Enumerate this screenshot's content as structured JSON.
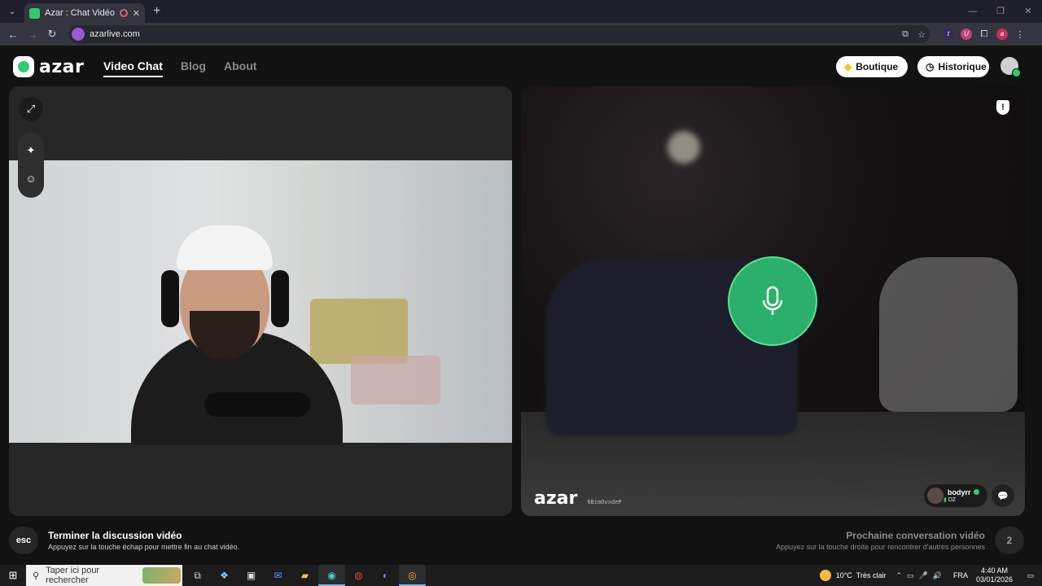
{
  "browser": {
    "tab_title": "Azar : Chat Vidéo avec de n",
    "tab_close": "✕",
    "new_tab": "+",
    "url": "azarlive.com",
    "ext_t": "t",
    "ext_u": "U",
    "profile": "a"
  },
  "nav": {
    "logo_text": "azar",
    "links": [
      "Video Chat",
      "Blog",
      "About"
    ],
    "boutique": "Boutique",
    "historique": "Historique"
  },
  "remote": {
    "watermark": "azar",
    "watermark_id": "6BimOvxdeP",
    "username": "bodyrr",
    "country": "DZ",
    "report": "!"
  },
  "footer": {
    "esc_key": "esc",
    "end_title": "Terminer la discussion vidéo",
    "end_sub": "Appuyez sur la touche échap pour mettre fin au chat vidéo.",
    "next_title": "Prochaine conversation vidéo",
    "next_sub": "Appuyez sur la touche droite pour rencontrer d'autres personnes",
    "next_key": "2"
  },
  "taskbar": {
    "search_placeholder": "Taper ici pour rechercher",
    "temperature": "10°C",
    "weather": "Très clair",
    "lang": "FRA",
    "time": "4:40 AM",
    "date": "03/01/2026"
  },
  "colors": {
    "accent": "#2ecc71",
    "mic_green": "#2bb06b"
  }
}
